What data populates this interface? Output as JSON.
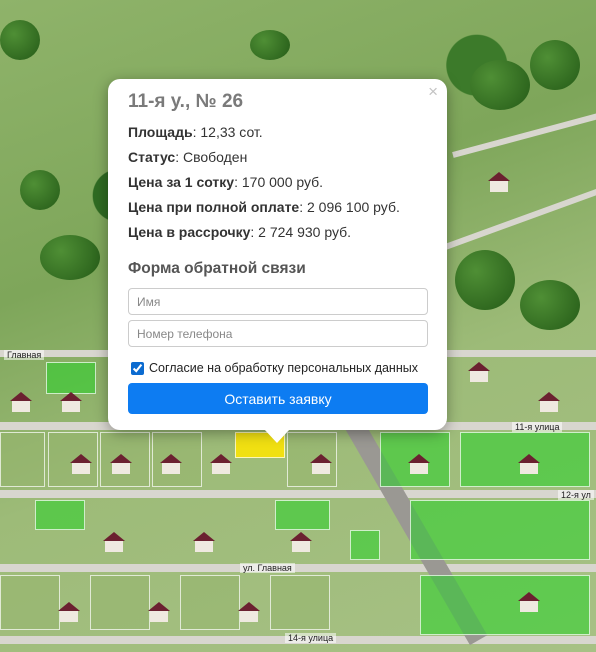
{
  "popup": {
    "title": "11-я у., № 26",
    "close_glyph": "×",
    "rows": [
      {
        "label": "Площадь",
        "value": ": 12,33 сот."
      },
      {
        "label": "Статус",
        "value": ": Свободен"
      },
      {
        "label": "Цена за 1 сотку",
        "value": ": 170 000 руб."
      },
      {
        "label": "Цена при полной оплате",
        "value": ": 2 096 100 руб."
      },
      {
        "label": "Цена в рассрочку",
        "value": ": 2 724 930 руб."
      }
    ],
    "form_title": "Форма обратной связи",
    "name_placeholder": "Имя",
    "phone_placeholder": "Номер телефона",
    "consent_label": "Согласие на обработку персональных данных",
    "consent_checked": true,
    "submit_label": "Оставить заявку"
  },
  "map": {
    "streets": [
      "Главная",
      "11-я улица",
      "12-я ул",
      "ул. Главная",
      "14-я улица"
    ],
    "colors": {
      "free_plot": "#28d228",
      "selected_plot": "#ffe600",
      "roof": "#6b2130",
      "button": "#0d7cf2"
    }
  }
}
